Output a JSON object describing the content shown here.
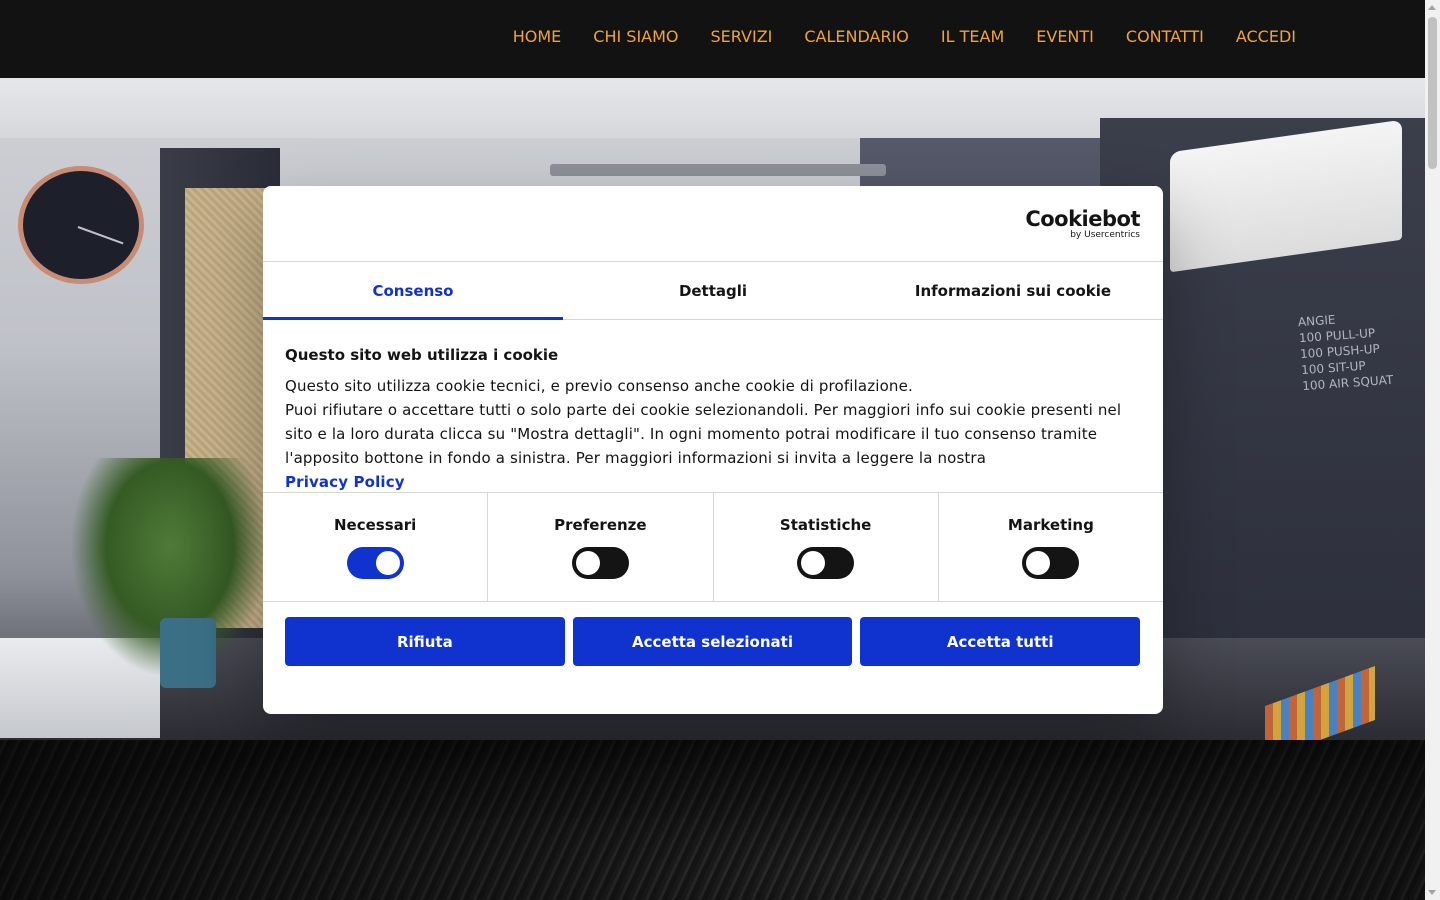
{
  "nav": {
    "items": [
      "HOME",
      "CHI SIAMO",
      "SERVIZI",
      "CALENDARIO",
      "IL TEAM",
      "EVENTI",
      "CONTATTI",
      "ACCEDI"
    ]
  },
  "hero": {
    "chalkboard_lines": [
      "ANGIE",
      "100 PULL-UP",
      "100 PUSH-UP",
      "100 SIT-UP",
      "100 AIR SQUAT"
    ]
  },
  "cookie_dialog": {
    "logo_brand": "Cookiebot",
    "logo_sub": "by Usercentrics",
    "tabs": [
      "Consenso",
      "Dettagli",
      "Informazioni sui cookie"
    ],
    "active_tab": "Consenso",
    "heading": "Questo sito web utilizza i cookie",
    "body_line1": "Questo sito utilizza cookie tecnici, e previo consenso anche cookie di profilazione.",
    "body_line2": "Puoi rifiutare o accettare tutti o solo parte dei cookie selezionandoli. Per maggiori info sui cookie presenti nel sito e la loro durata clicca su \"Mostra dettagli\". In ogni momento potrai modificare il tuo consenso tramite l'apposito bottone in fondo a sinistra. Per maggiori informazioni si invita a leggere la nostra",
    "privacy_link": "Privacy Policy",
    "categories": [
      {
        "label": "Necessari",
        "enabled": true
      },
      {
        "label": "Preferenze",
        "enabled": false
      },
      {
        "label": "Statistiche",
        "enabled": false
      },
      {
        "label": "Marketing",
        "enabled": false
      }
    ],
    "buttons": {
      "reject": "Rifiuta",
      "accept_selected": "Accetta selezionati",
      "accept_all": "Accetta tutti"
    },
    "accent_color": "#1032cf"
  },
  "theme": {
    "nav_link_color": "#f0a33a",
    "nav_bg": "#121212"
  }
}
